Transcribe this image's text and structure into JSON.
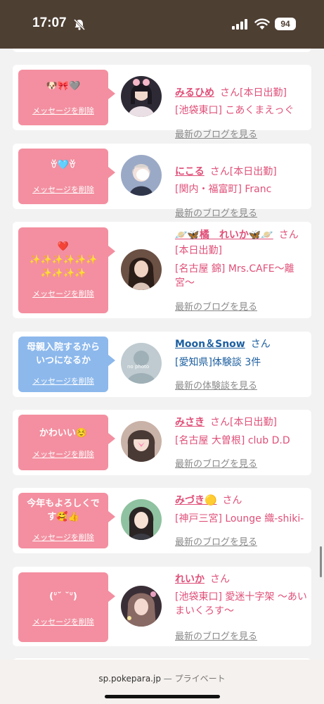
{
  "status": {
    "time": "17:07",
    "battery": "94"
  },
  "messages": [
    {
      "bubble": "🐶🎀🩶",
      "delete": "メッセージを削除",
      "name": "みるひめ",
      "san": "さん[本日出勤]",
      "shop": "[池袋東口] こあくまえっぐ",
      "blog": "最新のブログを見る",
      "avatar_color": "#2e2a35"
    },
    {
      "bubble": "ꈊ🩵ꈊ",
      "delete": "メッセージを削除",
      "name": "にこる",
      "san": "さん[本日出勤]",
      "shop": "[関内・福富町] Franc",
      "blog": "最新のブログを見る",
      "avatar_color": "#9aa9c6"
    },
    {
      "bubble": "❤️\n✨✨✨✨✨✨\n✨✨✨✨",
      "delete": "メッセージを削除",
      "name": "🪐🦋橘　れいか🦋🪐",
      "san": "さん[本日出勤]",
      "shop": "[名古屋 錦] Mrs.CAFE〜離宮〜",
      "blog": "最新のブログを見る",
      "avatar_color": "#6b5044"
    },
    {
      "bubble": "母親入院するから\nいつになるか",
      "delete": "メッセージを削除",
      "name": "Moon＆Snow",
      "san": "さん",
      "shop": "[愛知県]体験談 3件",
      "blog": "最新の体験談を見る",
      "avatar_color": "#bfcbd0",
      "avatar_text": "no photo"
    },
    {
      "bubble": "かわいい☺️",
      "delete": "メッセージを削除",
      "name": "みさき",
      "san": "さん[本日出勤]",
      "shop": "[名古屋 大曽根] club D.D",
      "blog": "最新のブログを見る",
      "avatar_color": "#c9b2a7"
    },
    {
      "bubble": "今年もよろしくで\nす🥰👍",
      "delete": "メッセージを削除",
      "name": "みづき🟡",
      "san": "さん",
      "shop": "[神戸三宮] Lounge 織-shiki-",
      "blog": "最新のブログを見る",
      "avatar_color": "#5a8a6a"
    },
    {
      "bubble": "(ᐡ˘ ˘ᐡ)",
      "delete": "メッセージを削除",
      "name": "れいか",
      "san": "さん",
      "shop": "[池袋東口] 愛迷十字架 〜あいまいくろす〜",
      "blog": "最新のブログを見る",
      "avatar_color": "#3a2e36"
    }
  ],
  "footer": {
    "domain": "sp.pokepara.jp",
    "separator": " — ",
    "mode": "プライベート"
  }
}
